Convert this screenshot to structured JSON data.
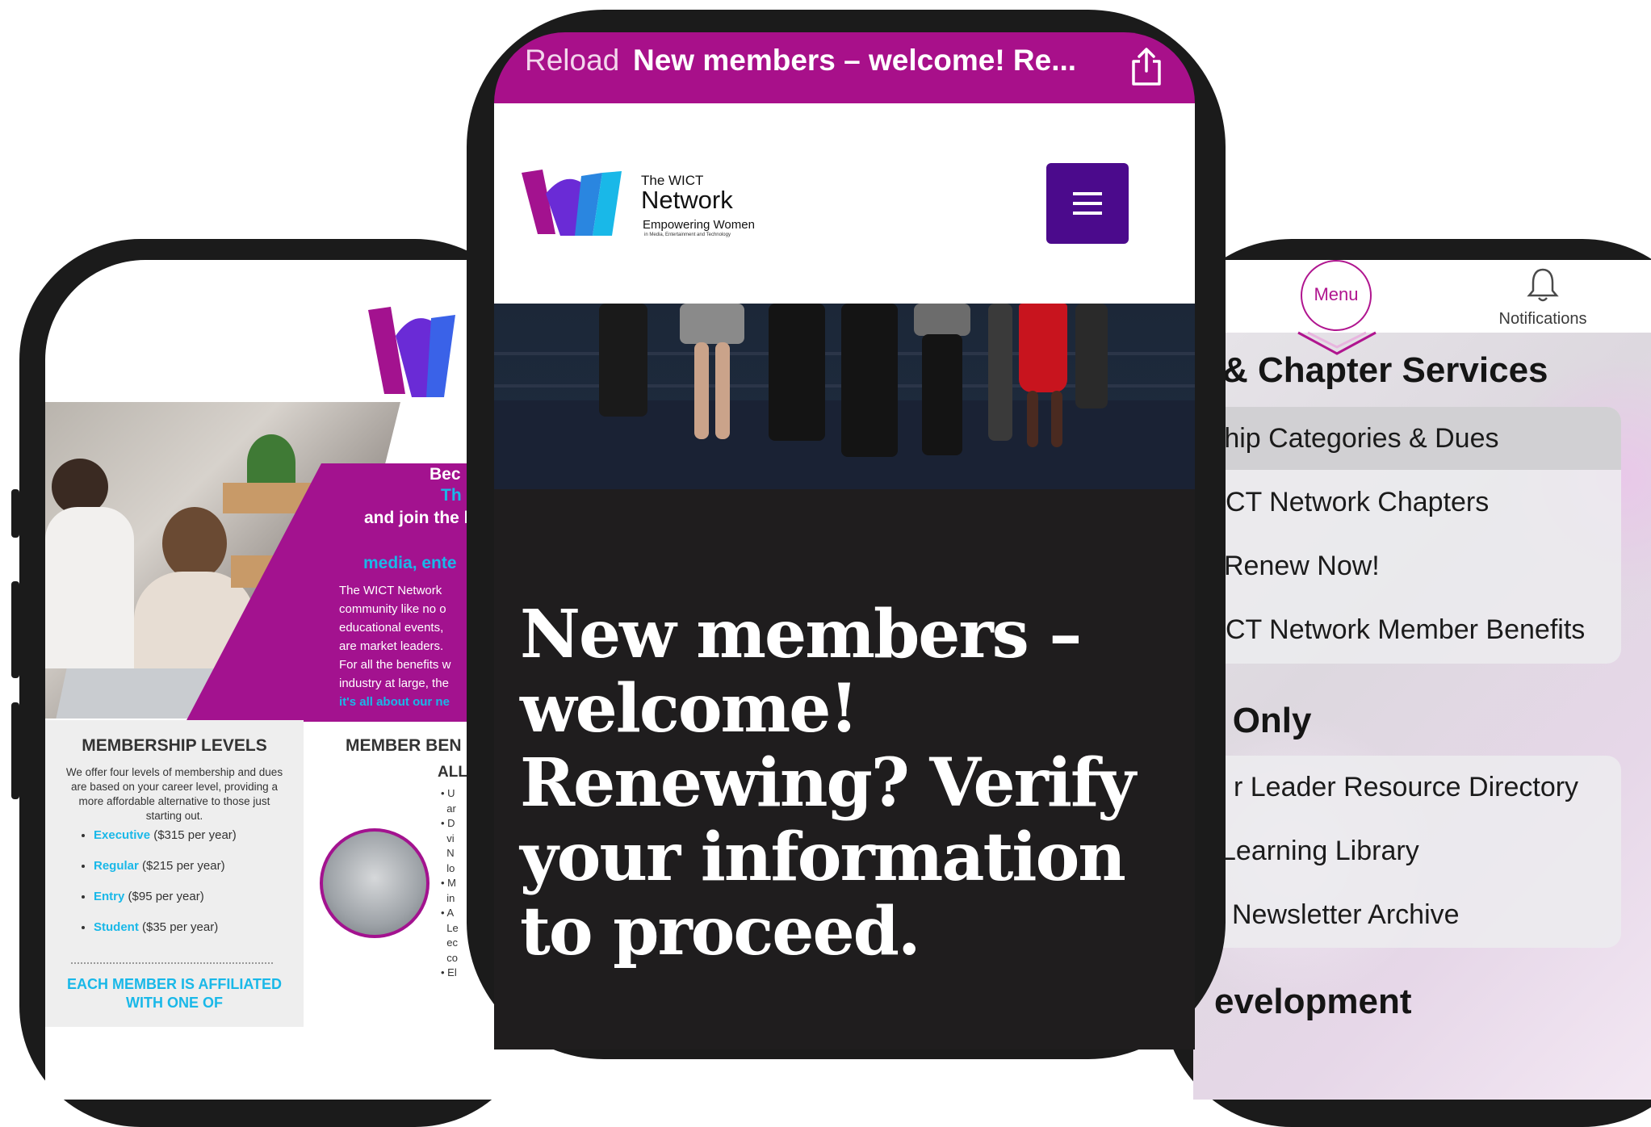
{
  "center": {
    "topbar": {
      "reload_label": "Reload",
      "page_title": "New members – welcome! Re..."
    },
    "header": {
      "logo_small": "The WICT",
      "logo_big": "Network",
      "logo_tagline": "Empowering Women",
      "logo_subtagline": "in Media, Entertainment and Technology"
    },
    "hero": {
      "heading": "New members – welcome! Renewing? Verify your information to proceed."
    }
  },
  "right": {
    "menu_button_label": "Menu",
    "notifications_label": "Notifications",
    "sections": [
      {
        "title": "& Chapter Services",
        "items": [
          "rship Categories & Dues",
          "CT Network Chapters",
          "Renew Now!",
          "CT Network Member Benefits"
        ]
      },
      {
        "title": "s Only",
        "items": [
          "r Leader Resource Directory",
          "Learning Library",
          "Newsletter Archive"
        ]
      },
      {
        "title": "evelopment",
        "items": []
      }
    ]
  },
  "left": {
    "flyer": {
      "headline_1": "Bec",
      "headline_2": "Th",
      "headline_3": "and join the l",
      "cyan_line": "media, ente",
      "body_lines": [
        "The WICT Network",
        "community like no o",
        "educational events,",
        "are market leaders.",
        "For all the benefits w",
        "industry at large, the",
        "it's all about our ne"
      ],
      "membership_title": "MEMBERSHIP LEVELS",
      "membership_desc": "We offer four levels of membership and dues are based on your career level, providing a more affordable alternative to those just starting out.",
      "levels": [
        {
          "name": "Executive",
          "price": "($315 per year)"
        },
        {
          "name": "Regular",
          "price": "($215 per year)"
        },
        {
          "name": "Entry",
          "price": "($95 per year)"
        },
        {
          "name": "Student",
          "price": "($35 per year)"
        }
      ],
      "affiliated_text": "EACH MEMBER IS AFFILIATED WITH ONE OF",
      "benefits_title": "MEMBER BEN",
      "benefits_sub": "ALL",
      "benefits_bullets": [
        "U",
        "ar",
        "D",
        "vi",
        "N",
        "lo",
        "M",
        "in",
        "A",
        "Le",
        "ec",
        "co",
        "El"
      ]
    }
  },
  "colors": {
    "magenta": "#a8108a",
    "purple_button": "#4b0a8c",
    "cyan": "#19b8e8",
    "hero_bg": "#1f1d1e"
  }
}
